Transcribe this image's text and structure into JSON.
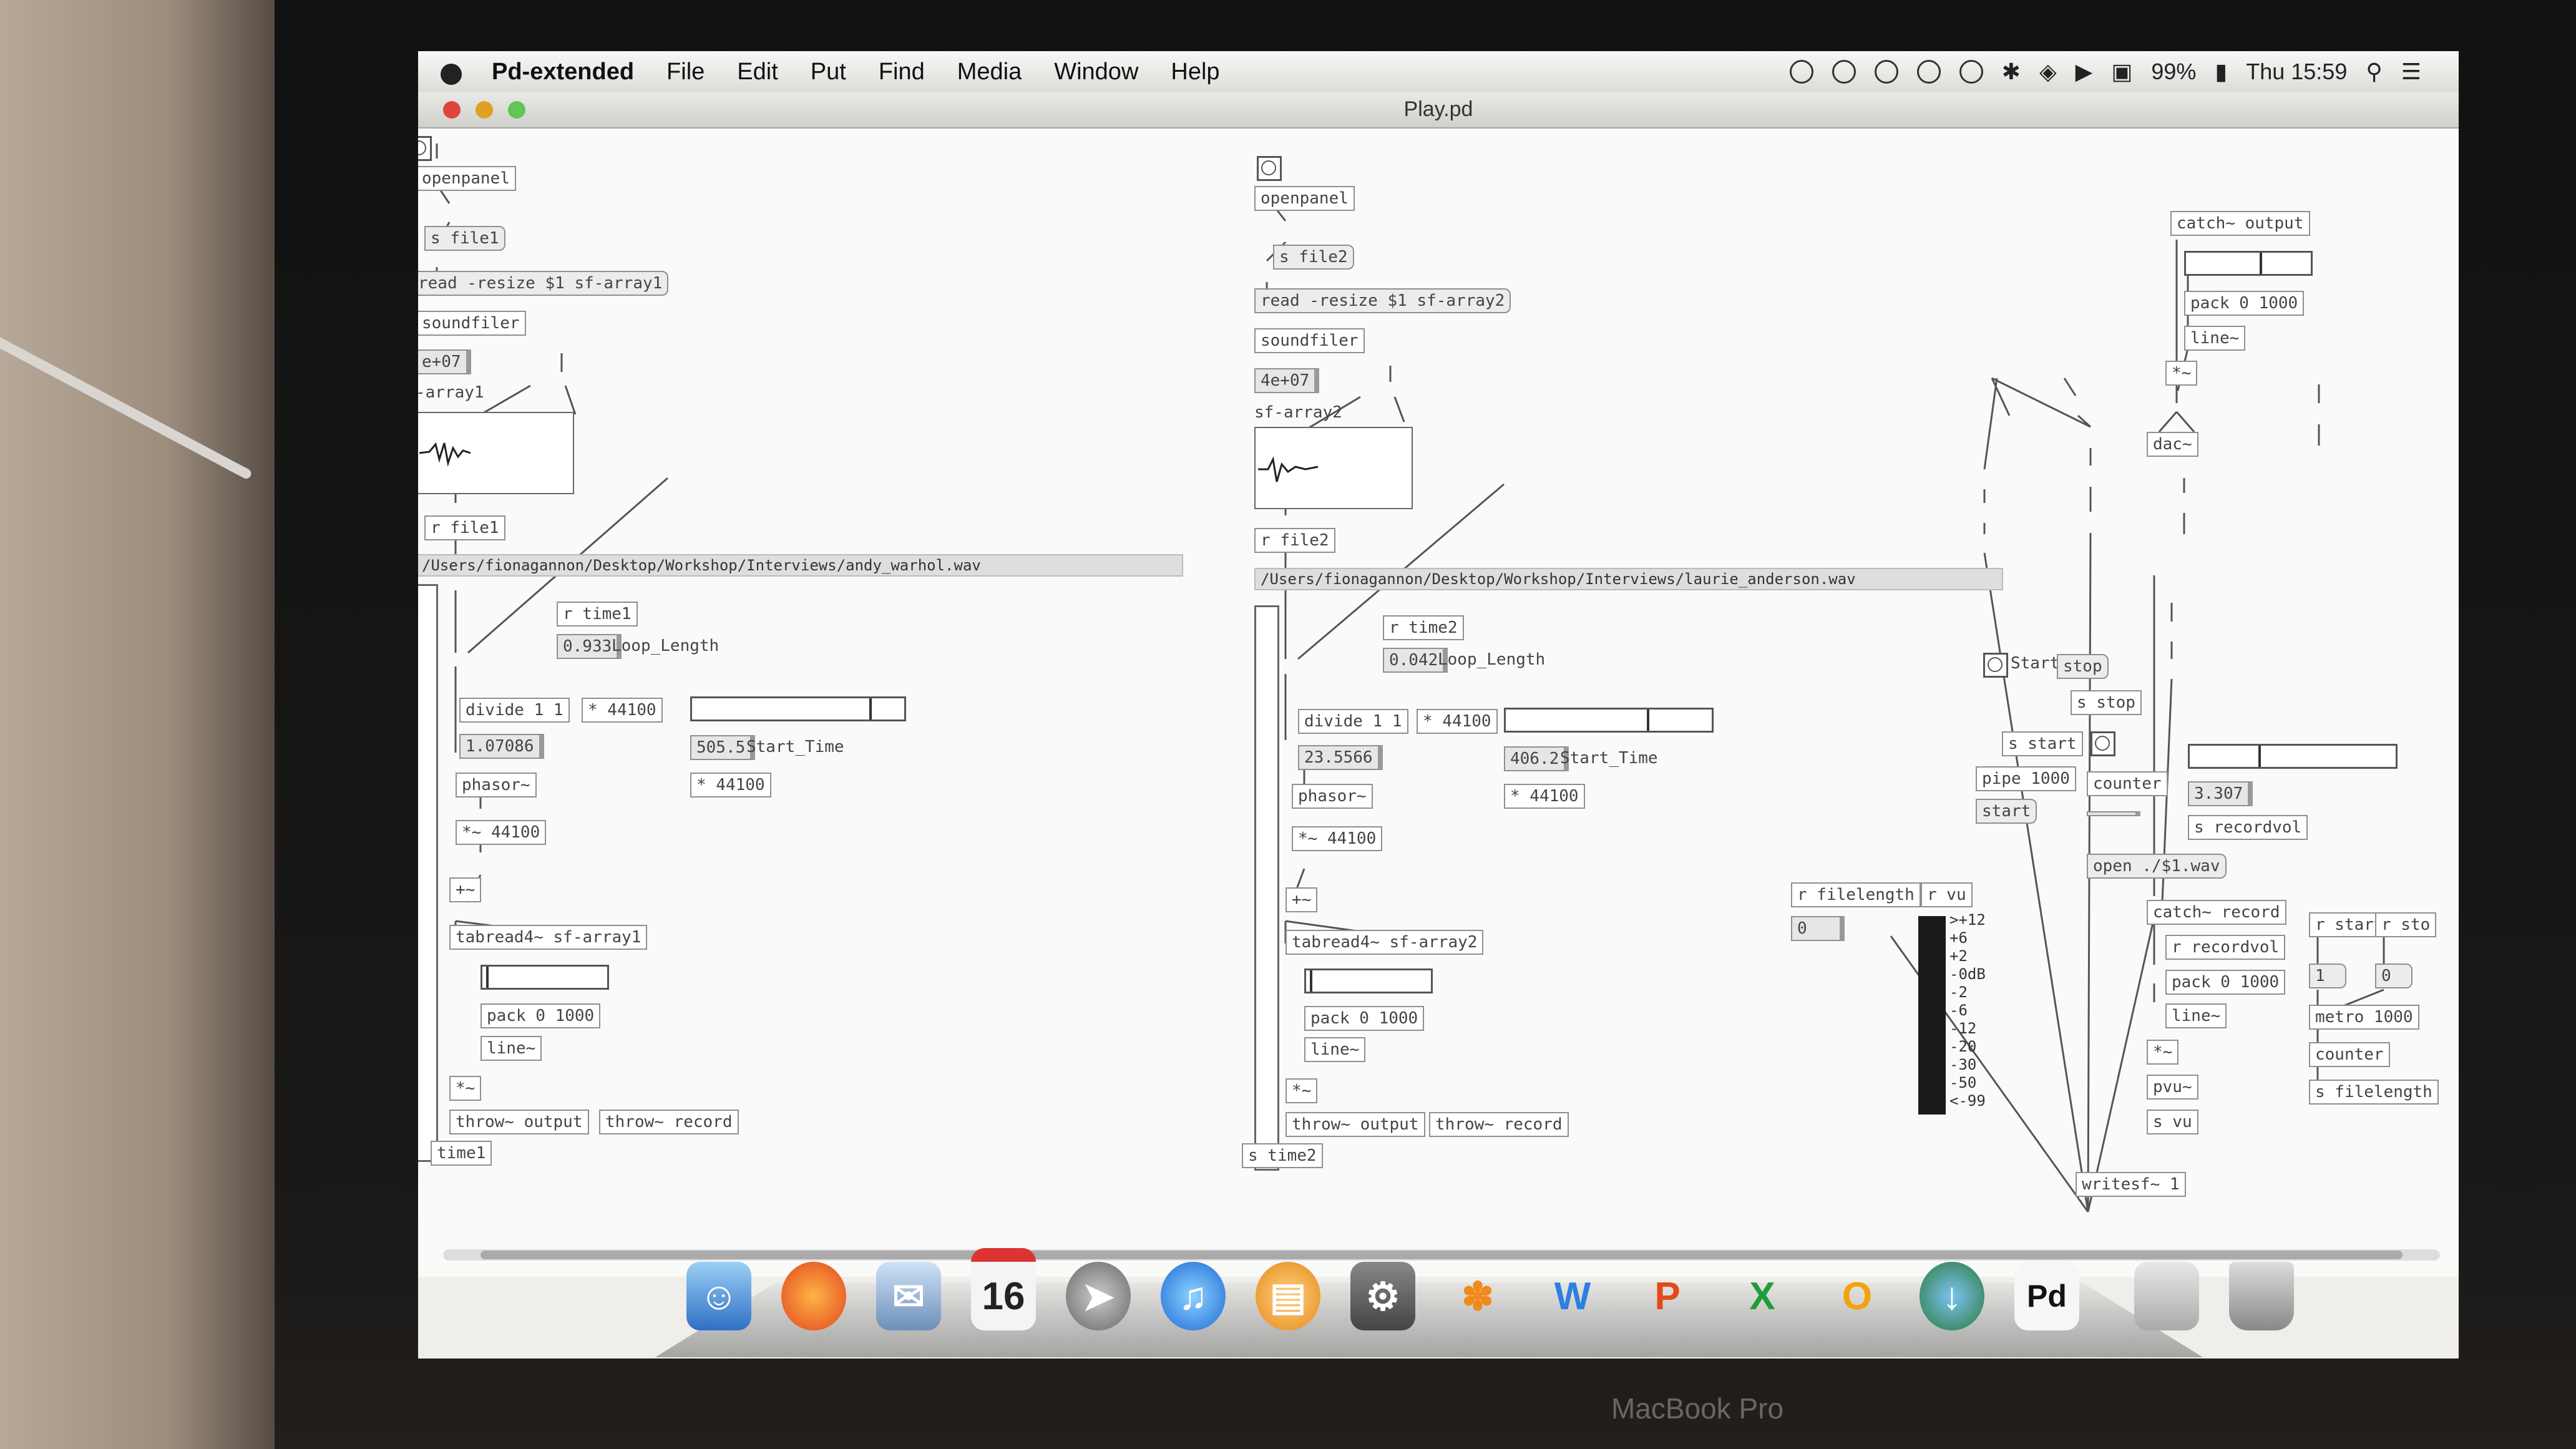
{
  "menubar": {
    "app_name": "Pd-extended",
    "menus": [
      "File",
      "Edit",
      "Put",
      "Find",
      "Media",
      "Window",
      "Help"
    ],
    "battery": "99%",
    "clock": "Thu 15:59"
  },
  "window": {
    "title": "Play.pd"
  },
  "patch": {
    "left": {
      "openpanel": "openpanel",
      "s_file": "s file1",
      "read": "read -resize $1 sf-array1",
      "soundfiler": "soundfiler",
      "soundfiler_out": "e+07",
      "array_name": "-array1",
      "r_file": "r file1",
      "path": "/Users/fionagannon/Desktop/Workshop/Interviews/andy_warhol.wav",
      "r_time": "r time1",
      "loop_length_value": "0.933",
      "loop_length_label": "Loop_Length",
      "divide": "divide 1 1",
      "mult": "* 44100",
      "divide_out": "1.07086",
      "phasor": "phasor~",
      "mult_sig": "*~ 44100",
      "start_time_value": "505.5",
      "start_time_label": "Start_Time",
      "mult2": "* 44100",
      "plus_sig": "+~",
      "tabread": "tabread4~ sf-array1",
      "pack": "pack 0 1000",
      "line": "line~",
      "times_sig": "*~",
      "throw_output": "throw~ output",
      "throw_record": "throw~ record",
      "s_time": "time1"
    },
    "middle": {
      "openpanel": "openpanel",
      "s_file": "s file2",
      "read": "read -resize $1 sf-array2",
      "soundfiler": "soundfiler",
      "soundfiler_out": "4e+07",
      "array_name": "sf-array2",
      "r_file": "r file2",
      "path": "/Users/fionagannon/Desktop/Workshop/Interviews/laurie_anderson.wav",
      "r_time": "r time2",
      "loop_length_value": "0.042",
      "loop_length_label": "Loop_Length",
      "divide": "divide 1 1",
      "mult": "* 44100",
      "divide_out": "23.5566",
      "phasor": "phasor~",
      "mult_sig": "*~ 44100",
      "start_time_value": "406.2",
      "start_time_label": "Start_Time",
      "mult2": "* 44100",
      "plus_sig": "+~",
      "tabread": "tabread4~ sf-array2",
      "pack": "pack 0 1000",
      "line": "line~",
      "times_sig": "*~",
      "throw_output": "throw~ output",
      "throw_record": "throw~ record",
      "s_time": "s time2"
    },
    "right": {
      "catch_output": "catch~ output",
      "pack": "pack 0 1000",
      "line": "line~",
      "times_sig": "*~",
      "dac": "dac~",
      "start_label": "Start",
      "stop_msg": "stop",
      "s_stop": "s stop",
      "s_start": "s start",
      "pipe": "pipe 1000",
      "start_msg": "start",
      "counter": "counter",
      "recordvol_value": "3.307",
      "s_recordvol": "s recordvol",
      "open_msg": "open ./$1.wav",
      "r_filelength": "r filelength",
      "filelength_value": "0",
      "r_vu": "r vu",
      "vu_scale": [
        ">+12",
        "+6",
        "+2",
        "-0dB",
        "-2",
        "-6",
        "-12",
        "-20",
        "-30",
        "-50",
        "<-99"
      ],
      "catch_record": "catch~ record",
      "r_recordvol": "r recordvol",
      "pack2": "pack 0 1000",
      "line2": "line~",
      "times_sig2": "*~",
      "pvu": "pvu~",
      "s_vu": "s vu",
      "writesf": "writesf~ 1",
      "r_start": "r start",
      "r_stop": "r sto",
      "one": "1",
      "zero": "0",
      "metro": "metro 1000",
      "counter2": "counter",
      "s_filelength": "s filelength"
    }
  },
  "dock": {
    "calendar_day": "16",
    "pd_label": "Pd"
  },
  "bezel": {
    "logo": "MacBook Pro"
  }
}
